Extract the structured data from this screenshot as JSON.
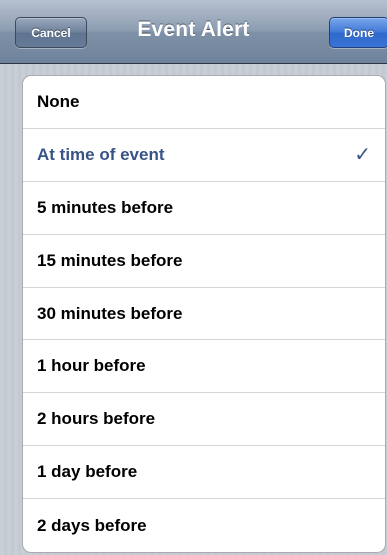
{
  "navbar": {
    "title": "Event Alert",
    "cancel_label": "Cancel",
    "done_label": "Done"
  },
  "alert_options": [
    {
      "label": "None",
      "selected": false
    },
    {
      "label": "At time of event",
      "selected": true
    },
    {
      "label": "5 minutes before",
      "selected": false
    },
    {
      "label": "15 minutes before",
      "selected": false
    },
    {
      "label": "30 minutes before",
      "selected": false
    },
    {
      "label": "1 hour before",
      "selected": false
    },
    {
      "label": "2 hours before",
      "selected": false
    },
    {
      "label": "1 day before",
      "selected": false
    },
    {
      "label": "2 days before",
      "selected": false
    }
  ],
  "icons": {
    "checkmark": "checkmark-icon"
  },
  "colors": {
    "selected_text": "#385487",
    "done_button": "#3f78d8",
    "cancel_button": "#6d819b"
  }
}
